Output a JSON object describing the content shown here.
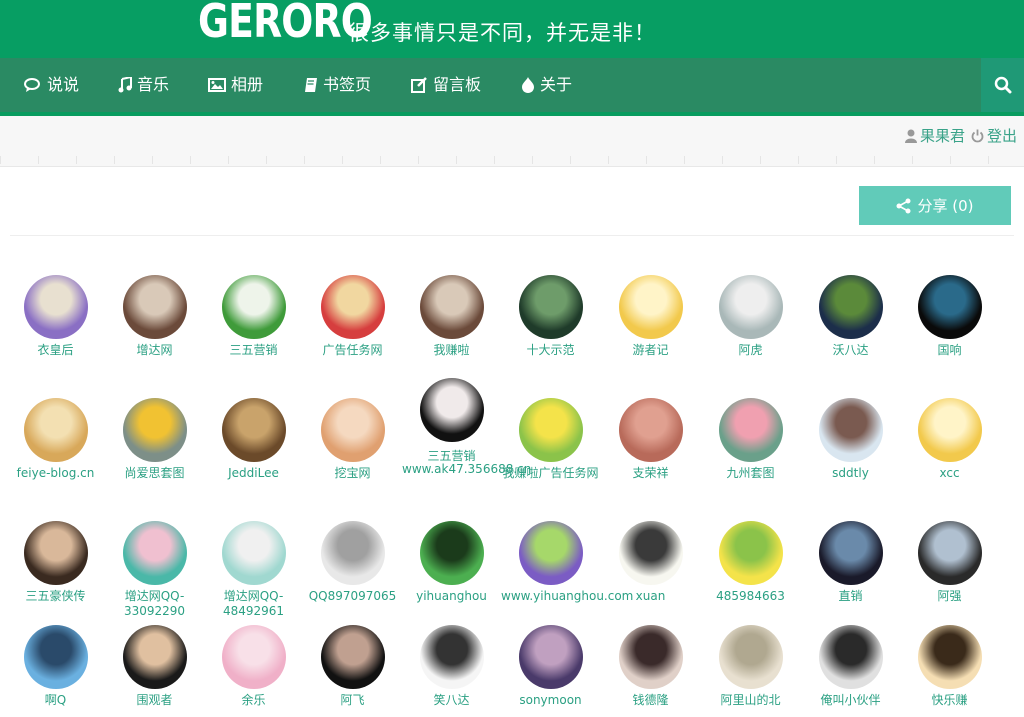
{
  "header": {
    "logo": "GERORO",
    "motto": "很多事情只是不同，并无是非！"
  },
  "nav": {
    "items": [
      {
        "label": "说说",
        "icon": "comments-icon"
      },
      {
        "label": "音乐",
        "icon": "music-icon"
      },
      {
        "label": "相册",
        "icon": "picture-icon"
      },
      {
        "label": "书签页",
        "icon": "book-icon"
      },
      {
        "label": "留言板",
        "icon": "edit-icon"
      },
      {
        "label": "关于",
        "icon": "drupal-icon"
      }
    ],
    "search_icon": "search-icon"
  },
  "userbar": {
    "username": "果果君",
    "logout": "登出"
  },
  "share": {
    "label": "分享 (0)"
  },
  "friends": [
    {
      "name": "衣皇后",
      "colors": [
        "#8a6fc4",
        "#e8e0d0"
      ]
    },
    {
      "name": "增达网",
      "colors": [
        "#6b4a3a",
        "#d9c9b8"
      ]
    },
    {
      "name": "三五营销",
      "colors": [
        "#3f9b3a",
        "#eef4ea"
      ]
    },
    {
      "name": "广告任务网",
      "colors": [
        "#d63e3e",
        "#f1d7a0"
      ]
    },
    {
      "name": "我赚啦",
      "colors": [
        "#6b4a3a",
        "#d9c9b8"
      ]
    },
    {
      "name": "十大示范",
      "colors": [
        "#1f3b2a",
        "#6e9c6a"
      ]
    },
    {
      "name": "游者记",
      "colors": [
        "#f2c94c",
        "#fff4c8"
      ]
    },
    {
      "name": "阿虎",
      "colors": [
        "#a9b8b8",
        "#eeeeee"
      ]
    },
    {
      "name": "沃八达",
      "colors": [
        "#1c2e4a",
        "#5b8a3a"
      ]
    },
    {
      "name": "国响",
      "colors": [
        "#0a0a0a",
        "#2a6a8a"
      ]
    },
    {
      "name": "feiye-blog.cn",
      "colors": [
        "#d8a85a",
        "#f3e0b2"
      ]
    },
    {
      "name": "尚爱思套图",
      "colors": [
        "#7d8f88",
        "#f1c232"
      ]
    },
    {
      "name": "JeddiLee",
      "colors": [
        "#6b4a2a",
        "#c9a36b"
      ]
    },
    {
      "name": "挖宝网",
      "colors": [
        "#e0a070",
        "#f5d9c0"
      ]
    },
    {
      "name": "三五营销",
      "colors": [
        "#111111",
        "#f0eaea"
      ]
    },
    {
      "name": "www.ak47.356688.cn",
      "colors": [
        "#8bc34a",
        "#f4e34a"
      ]
    },
    {
      "name": "我赚啦广告任务网",
      "colors": [
        "#8bc34a",
        "#f4e34a"
      ]
    },
    {
      "name": "支荣祥",
      "colors": [
        "#b86a5a",
        "#e0a090"
      ]
    },
    {
      "name": "九州套图",
      "colors": [
        "#6aa08a",
        "#f0a0b0"
      ]
    },
    {
      "name": "sddtly",
      "colors": [
        "#d9e6f0",
        "#7a5a50"
      ]
    },
    {
      "name": "xcc",
      "colors": [
        "#f2c94c",
        "#fff4c8"
      ]
    },
    {
      "name": "三五豪侠传",
      "colors": [
        "#3a2a20",
        "#d9b89a"
      ]
    },
    {
      "name": "增达网QQ-33092290",
      "colors": [
        "#4ab8a8",
        "#f0c0d0"
      ]
    },
    {
      "name": "增达网QQ-48492961",
      "colors": [
        "#a0d8d0",
        "#f0f0f0"
      ]
    },
    {
      "name": "QQ897097065",
      "colors": [
        "#e8e8e8",
        "#a0a0a0"
      ]
    },
    {
      "name": "yihuanghou",
      "colors": [
        "#4caf50",
        "#1b3b1b"
      ]
    },
    {
      "name": "www.yihuanghou.com",
      "colors": [
        "#7b5cc4",
        "#a6d86a"
      ]
    },
    {
      "name": "xuan",
      "colors": [
        "#f7f7f0",
        "#3a3a3a"
      ]
    },
    {
      "name": "485984663",
      "colors": [
        "#f4e34a",
        "#8bc34a"
      ]
    },
    {
      "name": "直销",
      "colors": [
        "#1a1a2a",
        "#6a8aaa"
      ]
    },
    {
      "name": "阿强",
      "colors": [
        "#2a2a2a",
        "#b0c0d0"
      ]
    },
    {
      "name": "啊Q",
      "colors": [
        "#6ab0e0",
        "#2a4a6a"
      ]
    },
    {
      "name": "围观者",
      "colors": [
        "#1a1a1a",
        "#e0c0a0"
      ]
    },
    {
      "name": "余乐",
      "colors": [
        "#f0b0c8",
        "#f8e0e8"
      ]
    },
    {
      "name": "阿飞",
      "colors": [
        "#111111",
        "#c0a090"
      ]
    },
    {
      "name": "笑八达",
      "colors": [
        "#f5f5f5",
        "#333333"
      ]
    },
    {
      "name": "sonymoon",
      "colors": [
        "#4a3a6a",
        "#c0a0c0"
      ]
    },
    {
      "name": "钱德隆",
      "colors": [
        "#e0d0c8",
        "#3a2a2a"
      ]
    },
    {
      "name": "阿里山的北",
      "colors": [
        "#e8e0d0",
        "#b0a890"
      ]
    },
    {
      "name": "俺叫小伙伴",
      "colors": [
        "#e0e0e0",
        "#2a2a2a"
      ]
    },
    {
      "name": "快乐赚",
      "colors": [
        "#f5deb3",
        "#3a2a1a"
      ]
    }
  ]
}
